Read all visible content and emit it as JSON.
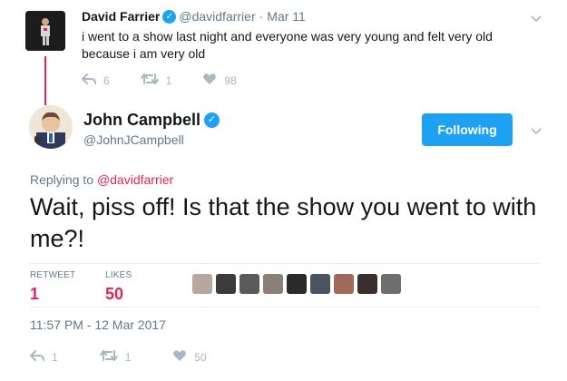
{
  "parent": {
    "name": "David Farrier",
    "handle": "@davidfarrier",
    "date": "Mar 11",
    "text": "i went to a show last night and everyone was very young and felt very old because i am very old",
    "reply_count": "6",
    "retweet_count": "1",
    "like_count": "98"
  },
  "main": {
    "name": "John Campbell",
    "handle": "@JohnJCampbell",
    "follow_label": "Following",
    "replying_prefix": "Replying to",
    "replying_handle": "@davidfarrier",
    "text": "Wait, piss off! Is that the show you went to with me?!",
    "stats": {
      "retweet_label": "RETWEET",
      "retweet_value": "1",
      "likes_label": "LIKES",
      "likes_value": "50"
    },
    "timestamp": "11:57 PM - 12 Mar 2017",
    "reply_count": "1",
    "retweet_count": "1",
    "like_count": "50"
  },
  "likers": [
    {
      "name": "liker-avatar-1",
      "color": "#b7a7a0"
    },
    {
      "name": "liker-avatar-2",
      "color": "#3b3b3b"
    },
    {
      "name": "liker-avatar-3",
      "color": "#5a5a5a"
    },
    {
      "name": "liker-avatar-4",
      "color": "#8c7f76"
    },
    {
      "name": "liker-avatar-5",
      "color": "#2a2a2a"
    },
    {
      "name": "liker-avatar-6",
      "color": "#4a5360"
    },
    {
      "name": "liker-avatar-7",
      "color": "#a06a5a"
    },
    {
      "name": "liker-avatar-8",
      "color": "#3a2e2e"
    },
    {
      "name": "liker-avatar-9",
      "color": "#6e6e6e"
    }
  ],
  "colors": {
    "accent_blue": "#1da1f2",
    "like_red": "#e0245e",
    "muted_text": "#657786",
    "icon_gray": "#aab8c2"
  },
  "icons": {
    "reply": "reply-icon",
    "retweet": "retweet-icon",
    "like": "heart-icon",
    "verified": "verified-badge-icon",
    "caret": "chevron-down-icon"
  }
}
